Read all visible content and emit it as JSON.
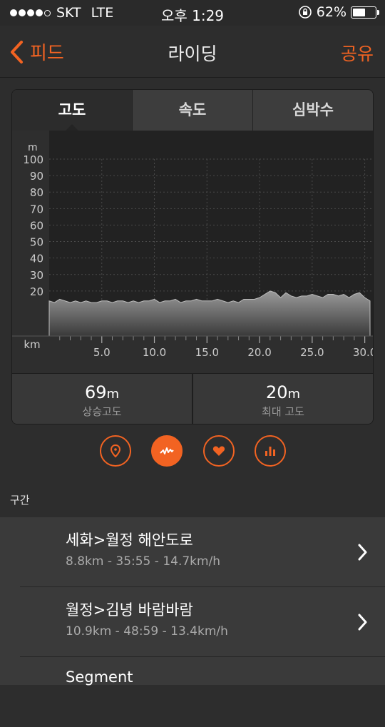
{
  "status_bar": {
    "carrier": "SKT",
    "network": "LTE",
    "time": "오후 1:29",
    "battery": "62%",
    "battery_level": 0.62
  },
  "nav": {
    "back_label": "피드",
    "title": "라이딩",
    "share_label": "공유"
  },
  "tabs": [
    {
      "label": "고도",
      "active": true
    },
    {
      "label": "속도",
      "active": false
    },
    {
      "label": "심박수",
      "active": false
    }
  ],
  "chart_data": {
    "type": "area",
    "ylabel": "m",
    "xlabel": "km",
    "y_ticks": [
      "100",
      "90",
      "80",
      "70",
      "60",
      "50",
      "40",
      "30",
      "20"
    ],
    "x_ticks": [
      "5.0",
      "10.0",
      "15.0",
      "20.0",
      "25.0",
      "30.0"
    ],
    "ylim": [
      10,
      100
    ],
    "xlim": [
      0,
      30.5
    ],
    "x": [
      0,
      0.5,
      1,
      1.5,
      2,
      2.5,
      3,
      3.5,
      4,
      4.5,
      5,
      5.5,
      6,
      6.5,
      7,
      7.5,
      8,
      8.5,
      9,
      9.5,
      10,
      10.5,
      11,
      11.5,
      12,
      12.5,
      13,
      13.5,
      14,
      14.5,
      15,
      15.5,
      16,
      16.5,
      17,
      17.5,
      18,
      18.5,
      19,
      19.5,
      20,
      20.5,
      21,
      21.5,
      22,
      22.5,
      23,
      23.5,
      24,
      24.5,
      25,
      25.5,
      26,
      26.5,
      27,
      27.5,
      28,
      28.5,
      29,
      29.5,
      30,
      30.5
    ],
    "values": [
      14,
      13,
      15,
      14,
      13,
      14,
      13,
      14,
      13,
      13,
      14,
      14,
      13,
      14,
      14,
      13,
      14,
      13,
      14,
      14,
      15,
      13,
      14,
      14,
      15,
      13,
      14,
      14,
      15,
      14,
      14,
      14,
      15,
      14,
      13,
      14,
      13,
      15,
      15,
      15,
      16,
      18,
      20,
      19,
      16,
      19,
      17,
      16,
      17,
      17,
      18,
      17,
      16,
      18,
      18,
      17,
      18,
      16,
      18,
      19,
      16,
      14
    ],
    "grid": true
  },
  "stats": [
    {
      "value": "69",
      "unit": "m",
      "label": "상승고도"
    },
    {
      "value": "20",
      "unit": "m",
      "label": "최대 고도"
    }
  ],
  "modes": [
    {
      "icon": "location-pin-icon",
      "active": false
    },
    {
      "icon": "elevation-graph-icon",
      "active": true
    },
    {
      "icon": "heart-icon",
      "active": false
    },
    {
      "icon": "bar-chart-icon",
      "active": false
    }
  ],
  "section_label": "구간",
  "segments": [
    {
      "name": "세화>월정 해안도로",
      "meta": "8.8km - 35:55 - 14.7km/h"
    },
    {
      "name": "월정>김녕 바람바람",
      "meta": "10.9km - 48:59 - 13.4km/h"
    },
    {
      "name": "Segment",
      "meta": ""
    }
  ],
  "colors": {
    "accent": "#f26322"
  }
}
